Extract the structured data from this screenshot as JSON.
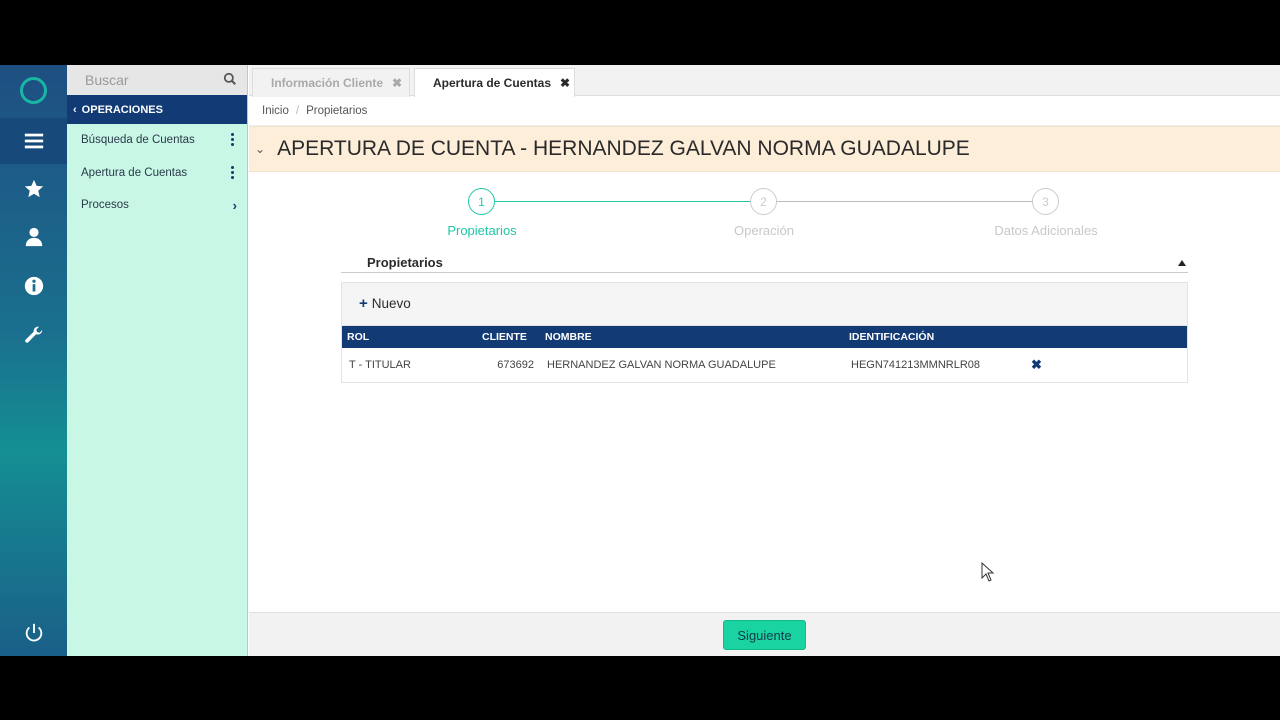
{
  "sidebar": {
    "search_placeholder": "Buscar",
    "section": "OPERACIONES",
    "items": [
      {
        "label": "Búsqueda de Cuentas"
      },
      {
        "label": "Apertura de Cuentas"
      },
      {
        "label": "Procesos"
      }
    ]
  },
  "tabs": [
    {
      "label": "Información Cliente"
    },
    {
      "label": "Apertura de Cuentas"
    }
  ],
  "breadcrumb": {
    "home": "Inicio",
    "current": "Propietarios"
  },
  "page_title": "APERTURA DE CUENTA - HERNANDEZ GALVAN NORMA GUADALUPE",
  "stepper": [
    {
      "number": "1",
      "label": "Propietarios"
    },
    {
      "number": "2",
      "label": "Operación"
    },
    {
      "number": "3",
      "label": "Datos Adicionales"
    }
  ],
  "panel": {
    "title": "Propietarios",
    "new_label": "Nuevo"
  },
  "table": {
    "columns": [
      "ROL",
      "CLIENTE",
      "NOMBRE",
      "IDENTIFICACIÓN"
    ],
    "rows": [
      {
        "rol": "T - TITULAR",
        "cliente": "673692",
        "nombre": "HERNANDEZ GALVAN NORMA GUADALUPE",
        "identificacion": "HEGN741213MMNRLR08"
      }
    ]
  },
  "footer": {
    "next_label": "Siguiente"
  },
  "colors": {
    "accent": "#19d3a0",
    "navy": "#123a74",
    "active_step": "#1fc7a6"
  }
}
